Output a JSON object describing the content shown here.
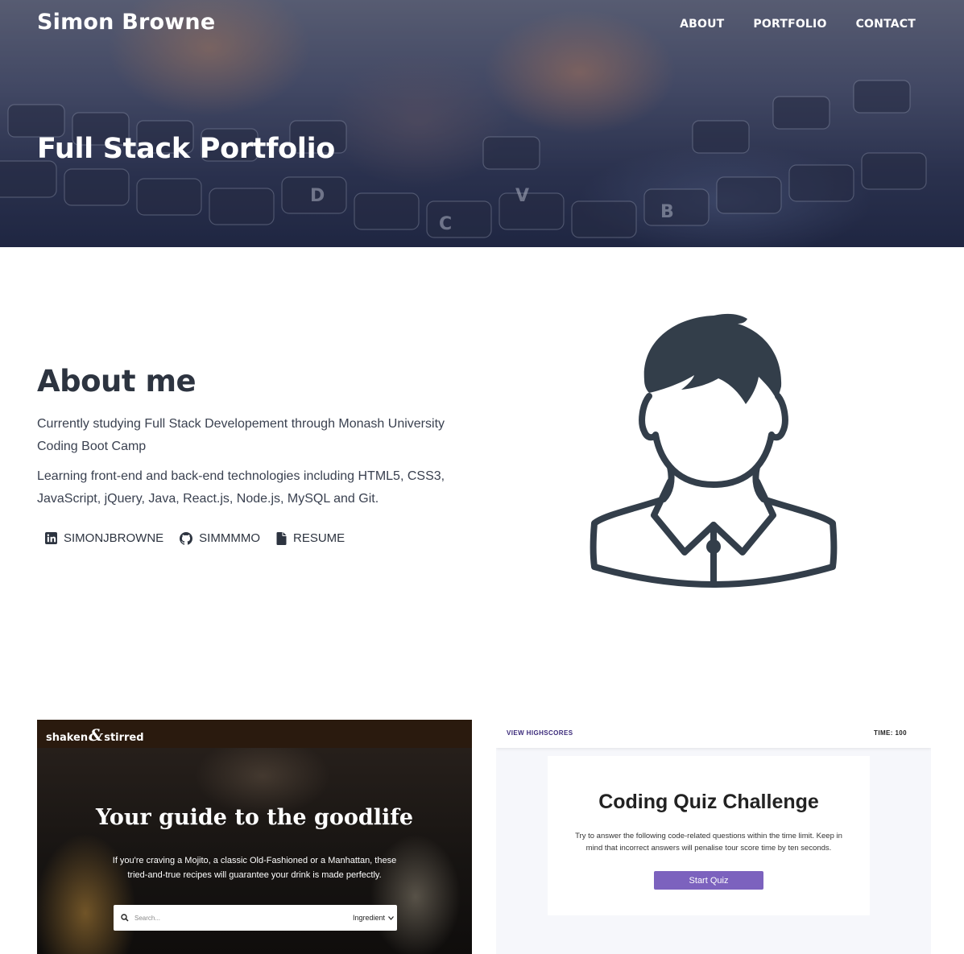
{
  "header": {
    "brand": "Simon Browne",
    "nav": [
      "ABOUT",
      "PORTFOLIO",
      "CONTACT"
    ],
    "hero_title": "Full Stack Portfolio"
  },
  "about": {
    "title": "About me",
    "paragraphs": [
      "Currently studying Full Stack Developement through Monash University Coding Boot Camp",
      "Learning front-end and back-end technologies including HTML5, CSS3, JavaScript, jQuery, Java, React.js, Node.js, MySQL and Git."
    ],
    "links": [
      {
        "label": "SIMONJBROWNE",
        "icon": "linkedin-icon"
      },
      {
        "label": "SIMMMMO",
        "icon": "github-icon"
      },
      {
        "label": "RESUME",
        "icon": "file-icon"
      }
    ],
    "avatar": "person-avatar-icon",
    "text_color": "#2d3440"
  },
  "projects": [
    {
      "logo_left": "shaken",
      "logo_amp": "&",
      "logo_right": "stirred",
      "heading": "Your guide to the goodlife",
      "subtitle": "If you're craving a Mojito, a classic Old-Fashioned or a Manhattan, these tried-and-true recipes will guarantee your drink is made perfectly.",
      "search_placeholder": "Search...",
      "select_value": "Ingredient"
    },
    {
      "highscores": "VIEW HIGHSCORES",
      "time": "TIME: 100",
      "heading": "Coding Quiz Challenge",
      "text": "Try to answer the following code-related questions within the time limit. Keep in mind that incorrect answers will penalise tour score time by ten seconds.",
      "button": "Start Quiz",
      "accent": "#7c62be"
    }
  ]
}
